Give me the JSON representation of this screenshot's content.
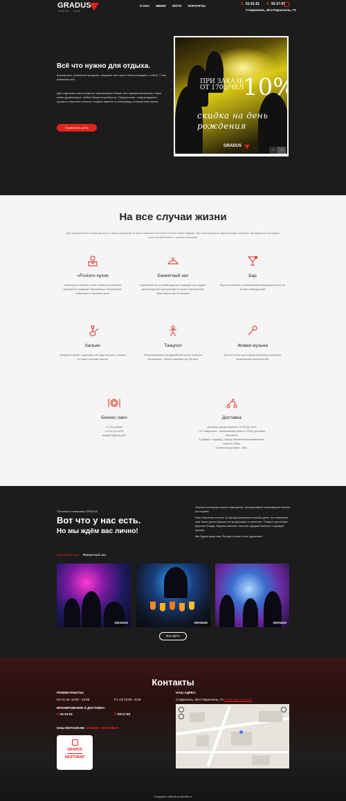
{
  "header": {
    "logo": "GRADUS",
    "logo_sub": "PRESS · BAR",
    "nav": [
      "О НАС",
      "МЕНЮ",
      "ФОТО",
      "КОНТАКТЫ"
    ],
    "phone1": "51-51-51",
    "phone2": "93-17-93",
    "address": "Ставрополь, 45-я Параллель, 7А"
  },
  "hero": {
    "title": "Всё что нужно для отдыха.",
    "text1": "Корпоратив, семейный праздник, свидание или просто вечер наедине с собой. У нас возможно всё.",
    "text2": "Два отдельных зала позволят организовать банкет или шумную вечеринку. Наше меню удовлетворит любые Ваши потребности. Оформление, сопровождение, музыка и персонал помогут создать именно ту атмосферу, которая Вам нужна.",
    "button": "Посмотреть меню",
    "promo_small": "ПРИ ЗАКАЗЕ\nОТ 1700/ЧЕЛ",
    "promo_big": "10%",
    "promo_script": "скидка на день рождения",
    "promo_logo": "GRADUS",
    "arrow_left": "‹",
    "arrow_right": "›"
  },
  "services": {
    "title": "На все случаи жизни",
    "subtitle": "Два оформленных по-разному зала, а также разделение их зоны позволяет воплотить в жизнь любую задумку. При этом идеальная звукоизоляция позволяет одновременно проводить классический банкет и шумную вечеринку.",
    "items": [
      {
        "icon": "chef-icon",
        "name": "«Fusion» кухня",
        "desc": "Наша кухня сочетает в себе элементы различных кулинарных традиций: Европейская, Итальянская, Кавказская и Японская кухни"
      },
      {
        "icon": "banquet-icon",
        "name": "Банкетный зал",
        "desc": "Отдельный зал, который идеально подойдет для свадеб, дней рождений, корпоративов и прочих мероприятий. Вместимость До 55 человек"
      },
      {
        "icon": "cocktail-icon",
        "name": "Бар",
        "desc": "Вкусные коктейли и неповторимая атмосфера никого не оставят равнодушным"
      },
      {
        "icon": "hookah-icon",
        "name": "Кальян",
        "desc": "Проводите время с друзьями, вас ждут кальяны, напитки из бара и вкусные закуски"
      },
      {
        "icon": "dance-icon",
        "name": "Танцпол",
        "desc": "Отменная музыка на диджейском пульте позволит потанцевать. Танцпол вмещает до 100 мест"
      },
      {
        "icon": "mic-icon",
        "name": "Живая музыка",
        "desc": "Мы постоянно приглашаем выступать различных музыкальных исполнителей"
      },
      {
        "icon": "plate-icon",
        "name": "Бизнес ланч",
        "desc": "от 200 рублей\nс 12:00 до 16:00\nкаждый будний день"
      },
      {
        "icon": "delivery-icon",
        "name": "Доставка",
        "desc": "Доставка осуществляется с 10:00 до 23:00\nПо Ставрополю - минимальный заказ от 1000р, доставка бесплатно.\nВ Дёмино, Надежду, Татарку, Михайловск минимальный заказ от 2000р.\nСтоимость доставки - 300р."
      }
    ]
  },
  "gallery": {
    "small": "Постоянно повышаем GRADUS",
    "title": "Вот что у нас есть.",
    "title2": "Но мы ждём вас лично!",
    "right_p1": "Оцените интерьер нашего заведения, прочувствуйте атмосферой нашего ресторана.",
    "right_p2": "Наш персонал состоит из профессионалов в своём деле, это позволяет нам такое разнообразие не проигрывать в качестве. Повара приготовят вкусные блюда, бармен смешает напитки, диджей включит подойдёт музыку.",
    "right_p3": "Мы будем рады вам. Всегда готовы стать друзьями!",
    "tab1": "#Основной зал",
    "tab2": "#Банкетный зал",
    "photo_logo": "GRADUS",
    "button": "Все фото"
  },
  "contacts": {
    "title": "Контакты",
    "hours_label": "РЕЖИМ РАБОТЫ:",
    "hours1": "Пн-Чт, Вс 10:00 - 24:00",
    "hours2": "Пт, Сб 10:00 - 6:00",
    "booking_label": "БРОНИРОВАНИЕ И ДОСТАВКА:",
    "phone1": "51-51-51",
    "phone2": "93-17-93",
    "ig_label": "НАШ INSTAGRAM:",
    "ig_handle": "GRADUS_RESTOBAR",
    "ig_card1": "GRADUS",
    "ig_card2": "RESTOBAR",
    "addr_label": "НАШ АДРЕС:",
    "address": "Ставрополь, 45-я Параллель, 7А",
    "map_link": "Посмотреть в 2GIS",
    "footer": "Создание сайтов seo@elite.ru"
  },
  "colors": {
    "accent": "#e2241b",
    "dark": "#1c1c1c",
    "light": "#f5f5f5"
  }
}
